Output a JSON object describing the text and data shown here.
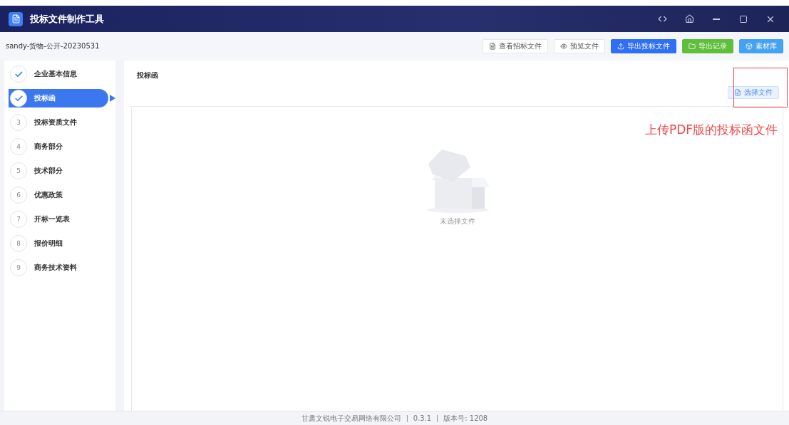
{
  "window": {
    "title": "投标文件制作工具"
  },
  "project": "sandy-货物-公开-20230531",
  "toolbar": [
    {
      "label": "查看招标文件",
      "kind": "plain"
    },
    {
      "label": "预览文件",
      "kind": "plain"
    },
    {
      "label": "导出投标文件",
      "kind": "primary"
    },
    {
      "label": "导出记录",
      "kind": "success"
    },
    {
      "label": "素材库",
      "kind": "info"
    }
  ],
  "steps": [
    {
      "label": "企业基本信息",
      "done": true,
      "selected": false
    },
    {
      "label": "投标函",
      "done": true,
      "selected": true
    },
    {
      "number": "3",
      "label": "投标资质文件",
      "done": false,
      "selected": false
    },
    {
      "number": "4",
      "label": "商务部分",
      "done": false,
      "selected": false
    },
    {
      "number": "5",
      "label": "技术部分",
      "done": false,
      "selected": false
    },
    {
      "number": "6",
      "label": "优惠政策",
      "done": false,
      "selected": false
    },
    {
      "number": "7",
      "label": "开标一览表",
      "done": false,
      "selected": false
    },
    {
      "number": "8",
      "label": "报价明细",
      "done": false,
      "selected": false
    },
    {
      "number": "9",
      "label": "商务技术资料",
      "done": false,
      "selected": false
    }
  ],
  "content": {
    "title": "投标函",
    "select_button": "选择文件",
    "empty_text": "未选择文件"
  },
  "annotation": "上传PDF版的投标函文件",
  "footer": {
    "company": "甘肃文锐电子交易网络有限公司",
    "version": "0.3.1",
    "build": "版本号: 1208"
  }
}
